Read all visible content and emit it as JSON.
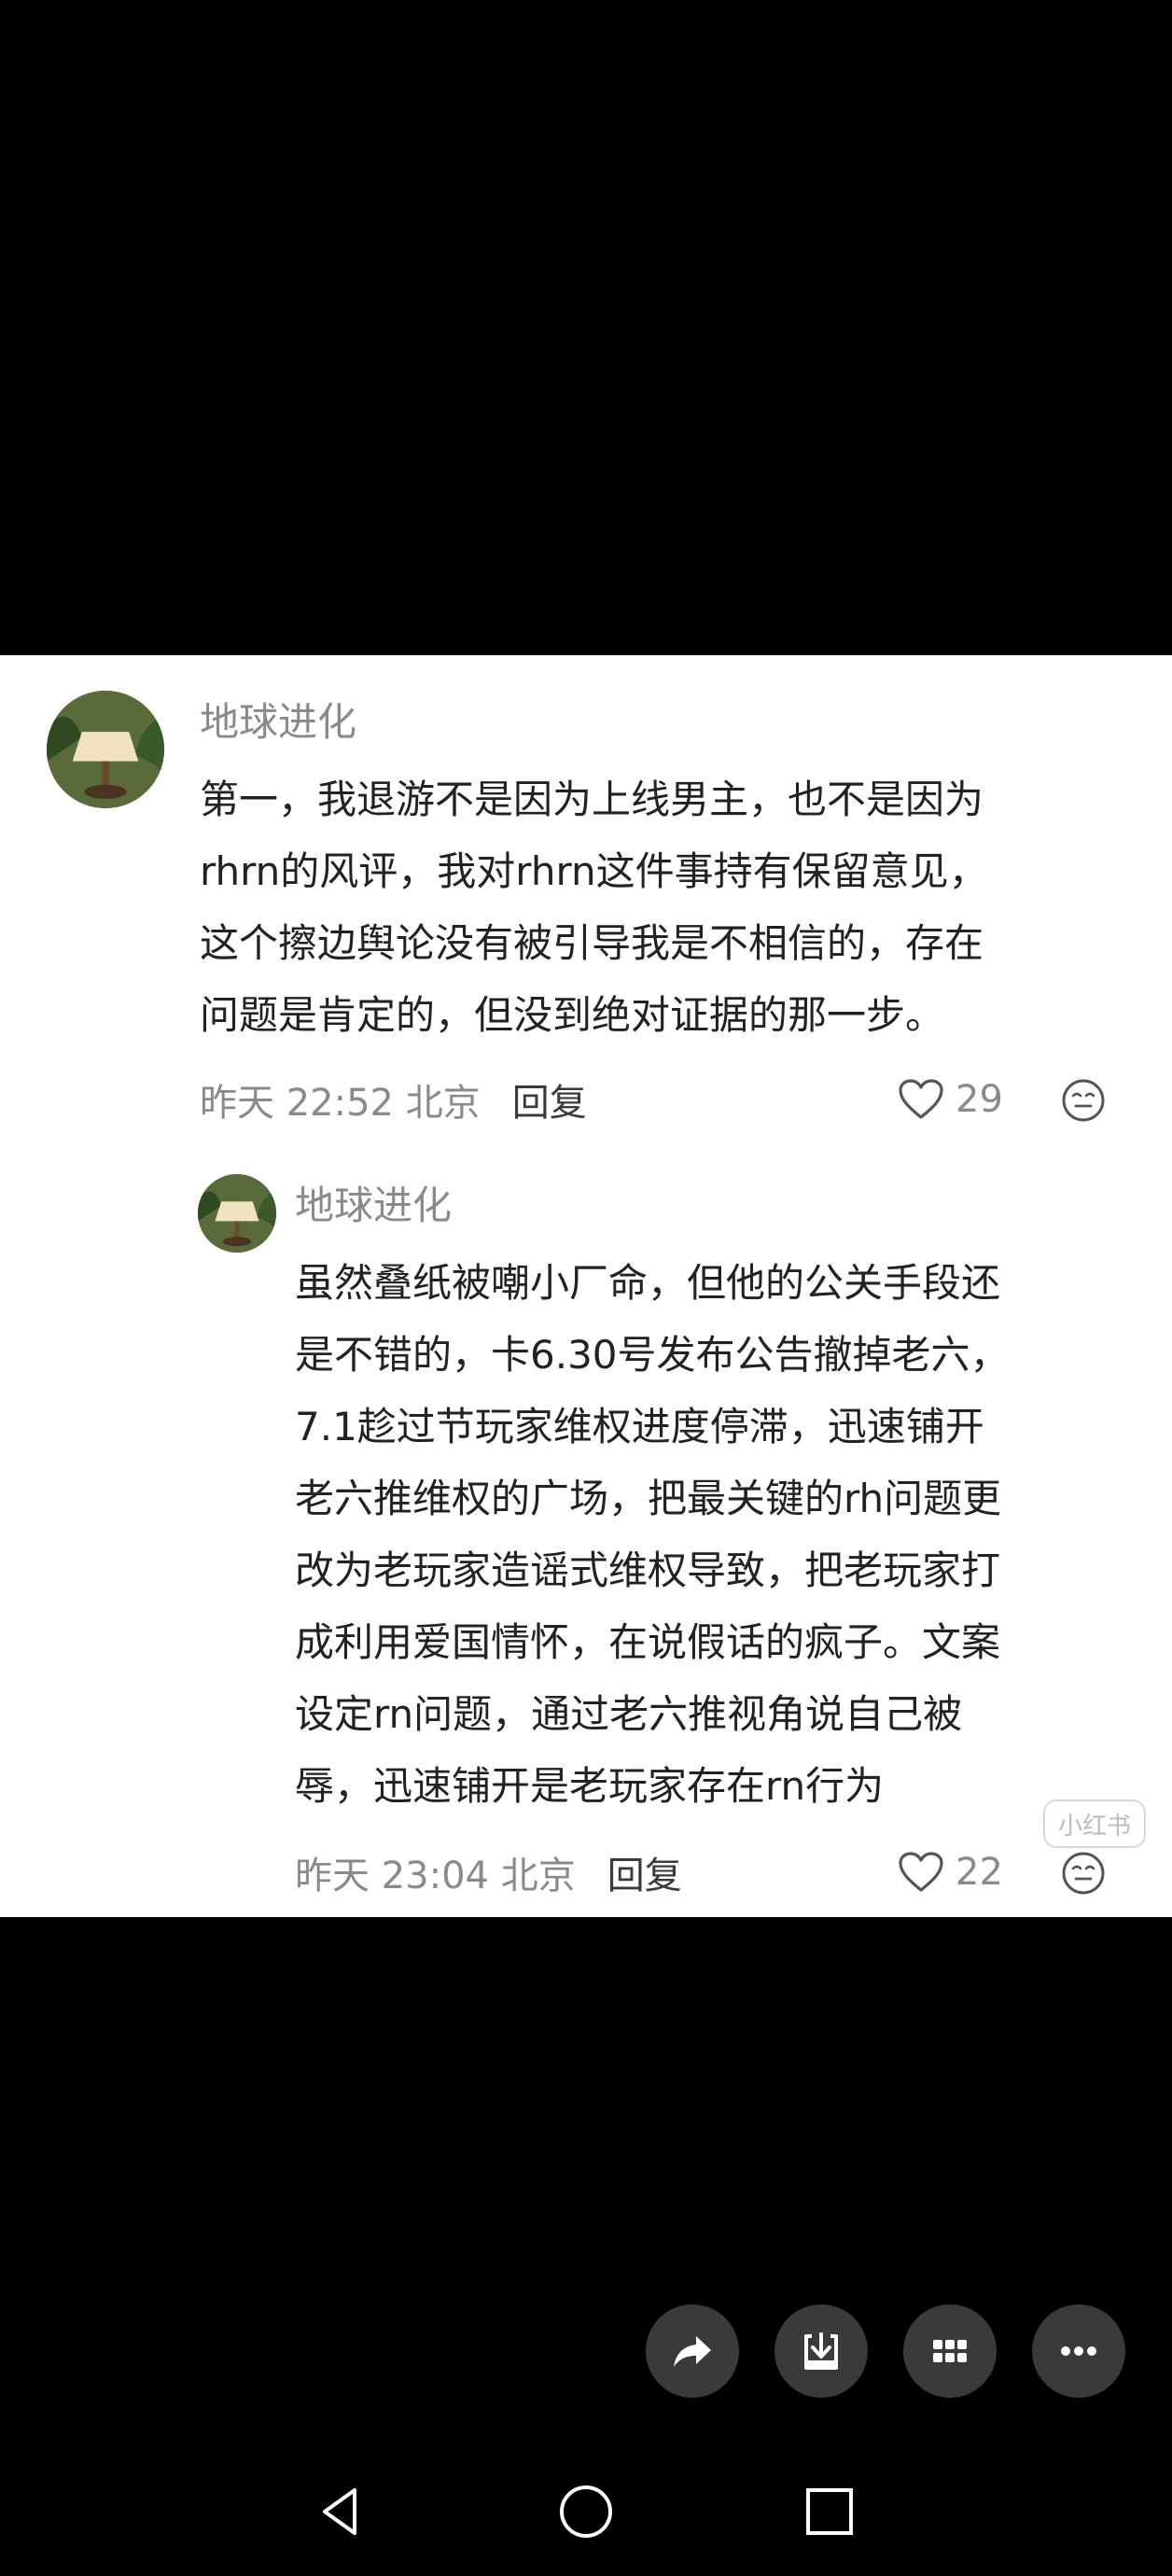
{
  "comments": [
    {
      "username": "地球进化",
      "lines": [
        "第一，我退游不是因为上线男主，也不是因为",
        "rhrn的风评，我对rhrn这件事持有保留意见，",
        "这个擦边舆论没有被引导我是不相信的，存在",
        "问题是肯定的，但没到绝对证据的那一步。"
      ],
      "time": "昨天 22:52 北京",
      "reply_label": "回复",
      "likes": "29"
    },
    {
      "username": "地球进化",
      "lines": [
        "虽然叠纸被嘲小厂命，但他的公关手段还",
        "是不错的，卡6.30号发布公告撤掉老六，",
        "7.1趁过节玩家维权进度停滞，迅速铺开",
        "老六推维权的广场，把最关键的rh问题更",
        "改为老玩家造谣式维权导致，把老玩家打",
        "成利用爱国情怀，在说假话的疯子。文案",
        "设定rn问题，通过老六推视角说自己被",
        "辱，迅速铺开是老玩家存在rn行为"
      ],
      "time": "昨天 23:04 北京",
      "reply_label": "回复",
      "likes": "22"
    }
  ],
  "watermark": "小红书",
  "action_buttons": [
    "share-icon",
    "download-icon",
    "grid-icon",
    "more-icon"
  ],
  "nav_buttons": [
    "back-icon",
    "home-icon",
    "recents-icon"
  ],
  "colors": {
    "background": "#000000",
    "card": "#ffffff",
    "muted_text": "#8a8a8a",
    "body_text": "#222222",
    "fab": "#3a3a3a"
  }
}
